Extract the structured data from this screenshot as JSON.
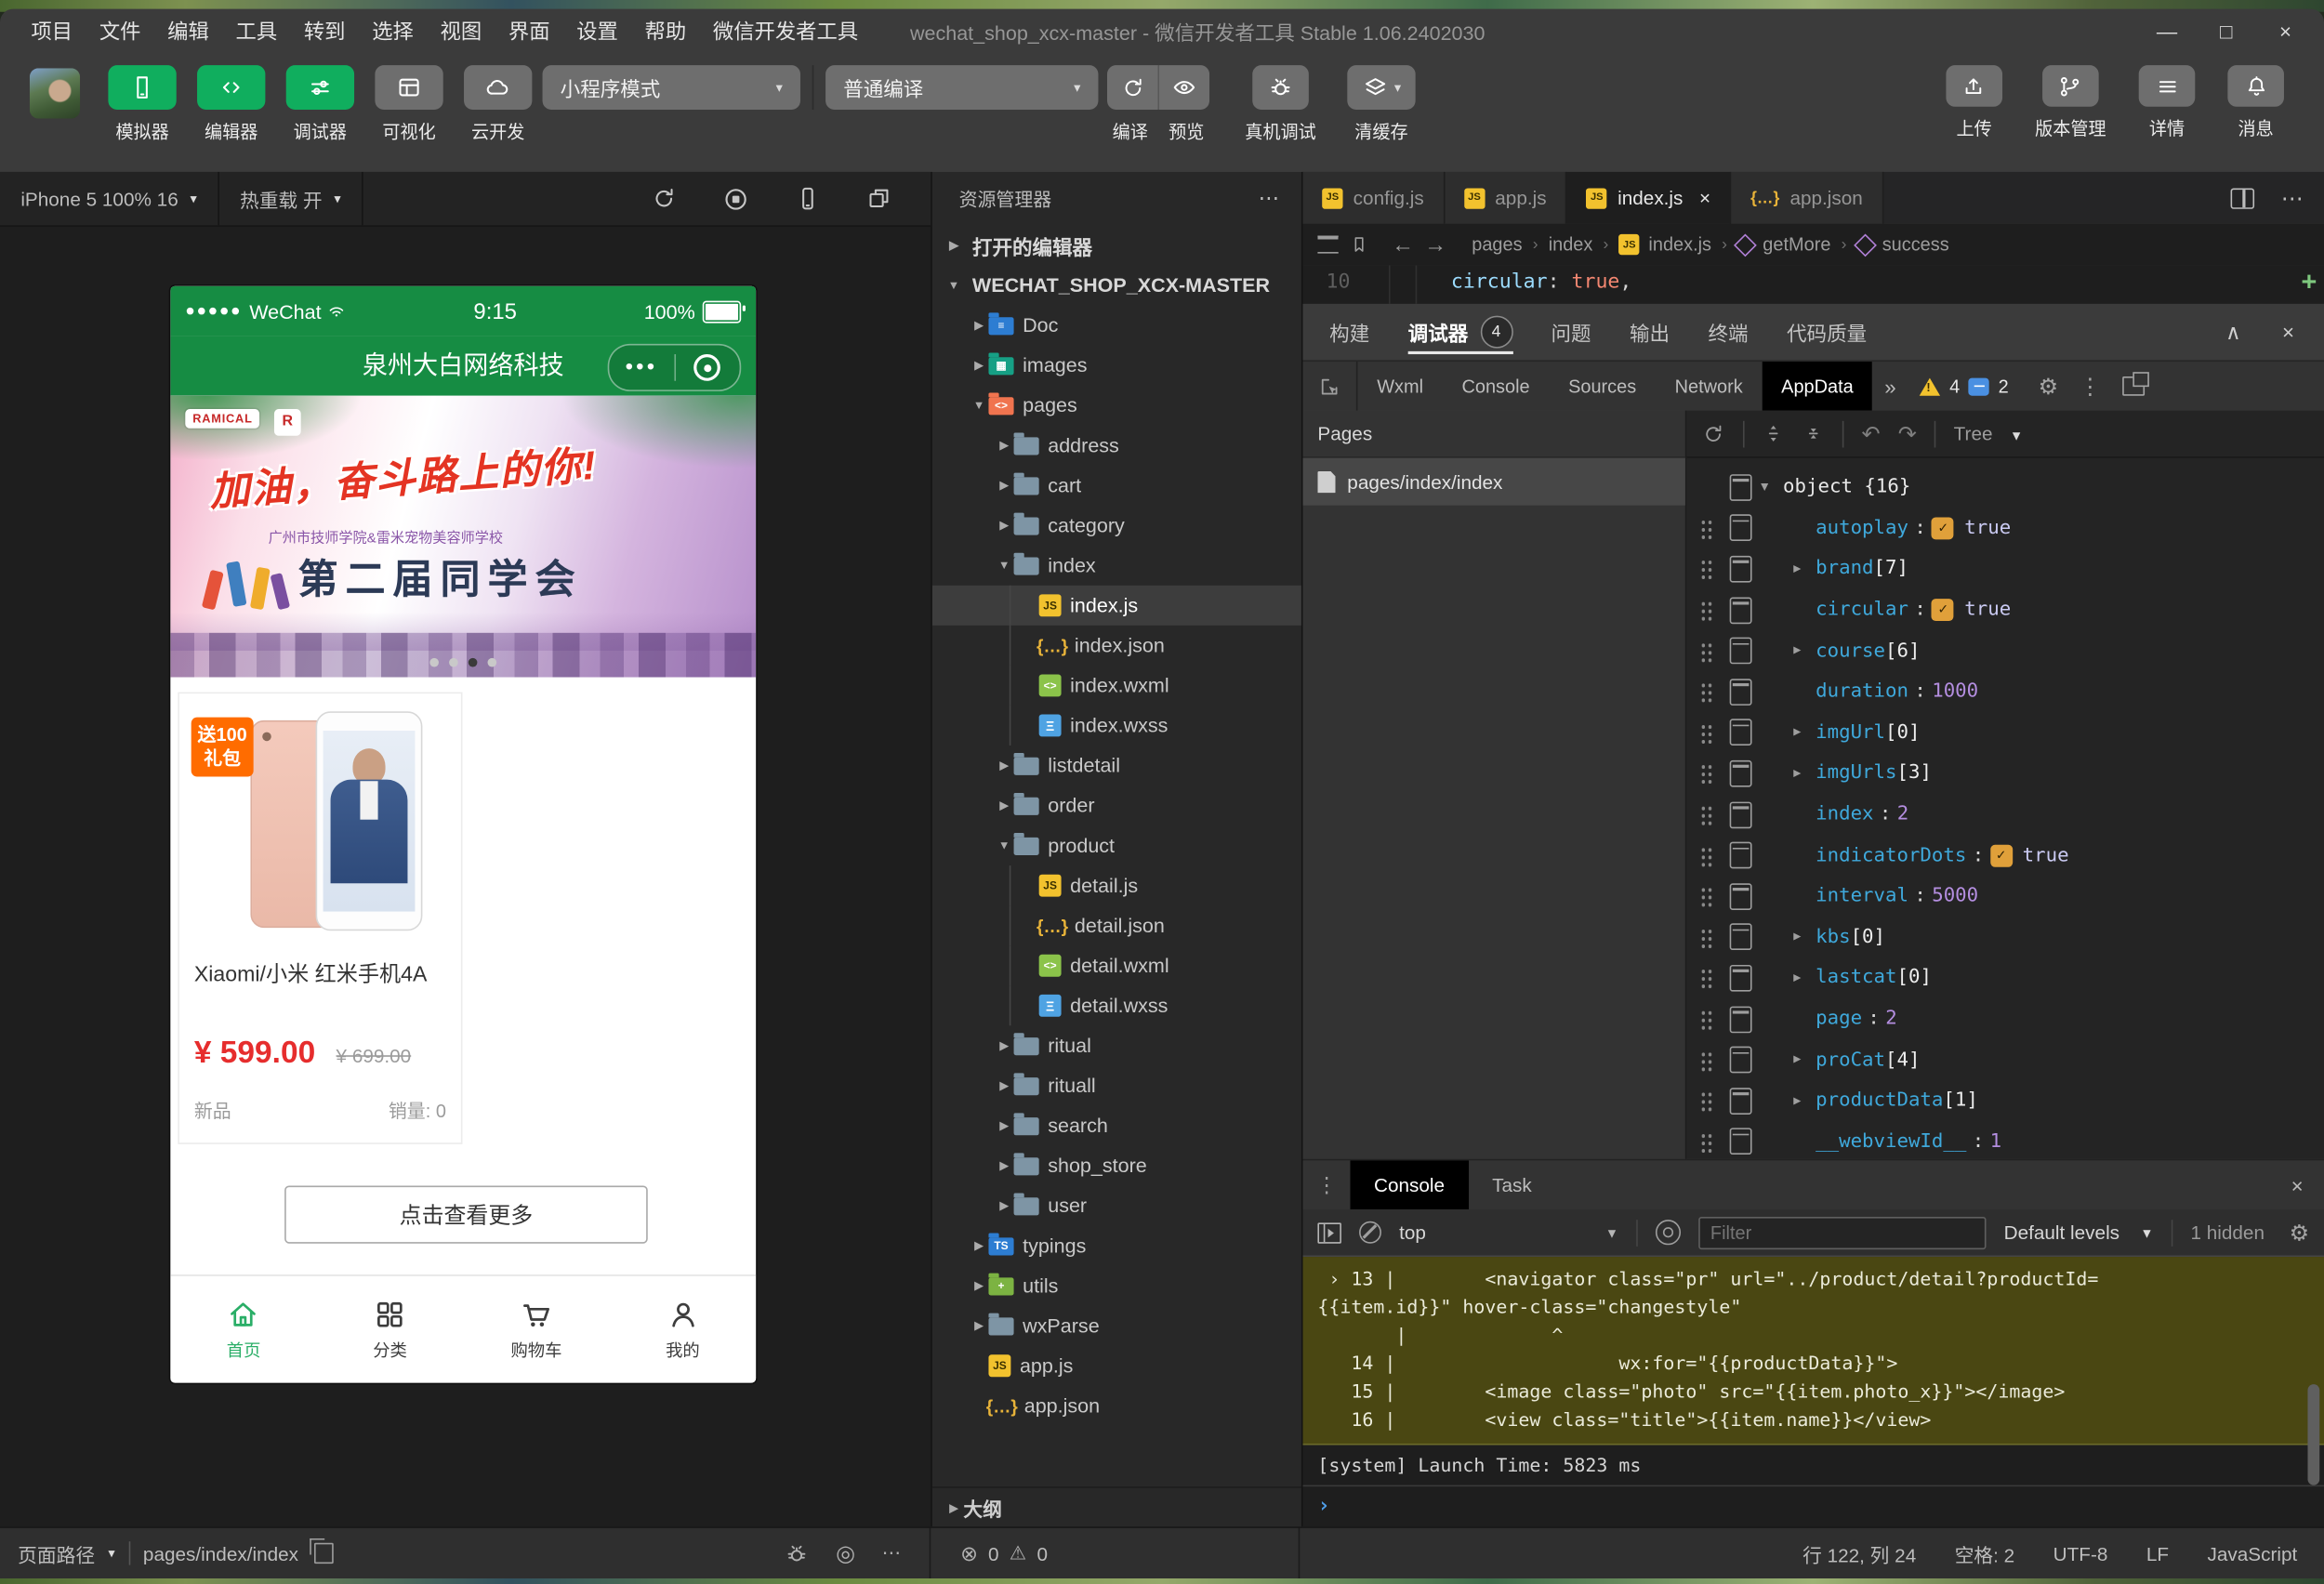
{
  "window": {
    "menus": [
      "项目",
      "文件",
      "编辑",
      "工具",
      "转到",
      "选择",
      "视图",
      "界面",
      "设置",
      "帮助",
      "微信开发者工具"
    ],
    "title": "wechat_shop_xcx-master - 微信开发者工具 Stable 1.06.2402030",
    "controls": {
      "minimize": "—",
      "maximize": "□",
      "close": "×"
    }
  },
  "toolbar": {
    "primary": [
      {
        "label": "模拟器",
        "icon": "phone",
        "active": true
      },
      {
        "label": "编辑器",
        "icon": "code",
        "active": true
      },
      {
        "label": "调试器",
        "icon": "sliders",
        "active": true
      },
      {
        "label": "可视化",
        "icon": "layout",
        "active": false
      },
      {
        "label": "云开发",
        "icon": "cloud",
        "active": false
      }
    ],
    "mode_select": "小程序模式",
    "compile_select": "普通编译",
    "compile_label": "编译",
    "preview_label": "预览",
    "remote_debug_label": "真机调试",
    "clear_cache_label": "清缓存",
    "right_actions": [
      {
        "label": "上传",
        "icon": "upload"
      },
      {
        "label": "版本管理",
        "icon": "branch"
      },
      {
        "label": "详情",
        "icon": "menu"
      },
      {
        "label": "消息",
        "icon": "bell"
      }
    ]
  },
  "simulator": {
    "device": "iPhone 5 100% 16",
    "hot_reload": "热重载 开"
  },
  "phone": {
    "status": {
      "signal": "●●●●●",
      "carrier": "WeChat",
      "time": "9:15",
      "battery": "100%"
    },
    "nav_title": "泉州大白网络科技",
    "banner": {
      "logo": "RAMICAL",
      "logo2": "R",
      "slogan": "加油，奋斗路上的你!",
      "subtitle": "广州市技师学院&雷米宠物美容师学校",
      "event": "第二届同学会",
      "dots": 4,
      "active_dot": 2
    },
    "product": {
      "badge_line1": "送100",
      "badge_line2": "礼包",
      "name": "Xiaomi/小米 红米手机4A",
      "price": "¥ 599.00",
      "original_price": "¥ 699.00",
      "tag": "新品",
      "sales": "销量: 0"
    },
    "more_button": "点击查看更多",
    "tabbar": [
      {
        "label": "首页",
        "icon": "home",
        "active": true
      },
      {
        "label": "分类",
        "icon": "grid",
        "active": false
      },
      {
        "label": "购物车",
        "icon": "cart",
        "active": false
      },
      {
        "label": "我的",
        "icon": "user",
        "active": false
      }
    ]
  },
  "explorer": {
    "header": "资源管理器",
    "more": "⋯",
    "tree": [
      {
        "label": "打开的编辑器",
        "icon": "none",
        "depth": 0,
        "arrow": "right",
        "bold": true
      },
      {
        "label": "WECHAT_SHOP_XCX-MASTER",
        "icon": "none",
        "depth": 0,
        "arrow": "down",
        "bold": true
      },
      {
        "label": "Doc",
        "icon": "folder-doc",
        "depth": 1,
        "arrow": "right"
      },
      {
        "label": "images",
        "icon": "folder-images",
        "depth": 1,
        "arrow": "right"
      },
      {
        "label": "pages",
        "icon": "folder-pages",
        "depth": 1,
        "arrow": "down"
      },
      {
        "label": "address",
        "icon": "folder",
        "depth": 2,
        "arrow": "right"
      },
      {
        "label": "cart",
        "icon": "folder",
        "depth": 2,
        "arrow": "right"
      },
      {
        "label": "category",
        "icon": "folder",
        "depth": 2,
        "arrow": "right"
      },
      {
        "label": "index",
        "icon": "folder-open",
        "depth": 2,
        "arrow": "down"
      },
      {
        "label": "index.js",
        "icon": "js",
        "depth": 3,
        "arrow": "none",
        "selected": true
      },
      {
        "label": "index.json",
        "icon": "json",
        "depth": 3,
        "arrow": "none"
      },
      {
        "label": "index.wxml",
        "icon": "wxml",
        "depth": 3,
        "arrow": "none"
      },
      {
        "label": "index.wxss",
        "icon": "wxss",
        "depth": 3,
        "arrow": "none"
      },
      {
        "label": "listdetail",
        "icon": "folder",
        "depth": 2,
        "arrow": "right"
      },
      {
        "label": "order",
        "icon": "folder",
        "depth": 2,
        "arrow": "right"
      },
      {
        "label": "product",
        "icon": "folder-open",
        "depth": 2,
        "arrow": "down"
      },
      {
        "label": "detail.js",
        "icon": "js",
        "depth": 3,
        "arrow": "none"
      },
      {
        "label": "detail.json",
        "icon": "json",
        "depth": 3,
        "arrow": "none"
      },
      {
        "label": "detail.wxml",
        "icon": "wxml",
        "depth": 3,
        "arrow": "none"
      },
      {
        "label": "detail.wxss",
        "icon": "wxss",
        "depth": 3,
        "arrow": "none"
      },
      {
        "label": "ritual",
        "icon": "folder",
        "depth": 2,
        "arrow": "right"
      },
      {
        "label": "rituall",
        "icon": "folder",
        "depth": 2,
        "arrow": "right"
      },
      {
        "label": "search",
        "icon": "folder",
        "depth": 2,
        "arrow": "right"
      },
      {
        "label": "shop_store",
        "icon": "folder",
        "depth": 2,
        "arrow": "right"
      },
      {
        "label": "user",
        "icon": "folder",
        "depth": 2,
        "arrow": "right"
      },
      {
        "label": "typings",
        "icon": "folder-ts",
        "depth": 1,
        "arrow": "right"
      },
      {
        "label": "utils",
        "icon": "folder-utils",
        "depth": 1,
        "arrow": "right"
      },
      {
        "label": "wxParse",
        "icon": "folder",
        "depth": 1,
        "arrow": "right"
      },
      {
        "label": "app.js",
        "icon": "js",
        "depth": 1,
        "arrow": "none"
      },
      {
        "label": "app.json",
        "icon": "json",
        "depth": 1,
        "arrow": "none"
      }
    ],
    "outline": "大纲"
  },
  "editor": {
    "tabs": [
      {
        "label": "config.js",
        "icon": "js",
        "active": false
      },
      {
        "label": "app.js",
        "icon": "js",
        "active": false
      },
      {
        "label": "index.js",
        "icon": "js",
        "active": true,
        "close": "×"
      },
      {
        "label": "app.json",
        "icon": "json",
        "active": false
      }
    ],
    "breadcrumb": [
      {
        "label": "pages",
        "icon": "none"
      },
      {
        "label": "index",
        "icon": "none"
      },
      {
        "label": "index.js",
        "icon": "js"
      },
      {
        "label": "getMore",
        "icon": "symbol"
      },
      {
        "label": "success",
        "icon": "symbol"
      }
    ],
    "code": {
      "line_number": "10",
      "tokens": [
        {
          "t": "circular",
          "c": "key"
        },
        {
          "t": ": ",
          "c": "plain"
        },
        {
          "t": "true",
          "c": "val"
        },
        {
          "t": ",",
          "c": "plain"
        }
      ]
    }
  },
  "debugger": {
    "panel_tabs": [
      {
        "label": "构建",
        "active": false
      },
      {
        "label": "调试器",
        "active": true,
        "badge": "4"
      },
      {
        "label": "问题",
        "active": false
      },
      {
        "label": "输出",
        "active": false
      },
      {
        "label": "终端",
        "active": false
      },
      {
        "label": "代码质量",
        "active": false
      }
    ],
    "collapse": "∧",
    "close": "×",
    "devtools_tabs": [
      {
        "label": "Wxml",
        "active": false
      },
      {
        "label": "Console",
        "active": false
      },
      {
        "label": "Sources",
        "active": false
      },
      {
        "label": "Network",
        "active": false
      },
      {
        "label": "AppData",
        "active": true
      }
    ],
    "more": "»",
    "warning_count": "4",
    "message_count": "2"
  },
  "appdata": {
    "pages_header": "Pages",
    "page_item": "pages/index/index",
    "tree_mode": "Tree",
    "root": "object {16}",
    "entries": [
      {
        "key": "autoplay",
        "type": "bool",
        "value": "true"
      },
      {
        "key": "brand",
        "type": "array",
        "value": "[7]"
      },
      {
        "key": "circular",
        "type": "bool",
        "value": "true"
      },
      {
        "key": "course",
        "type": "array",
        "value": "[6]"
      },
      {
        "key": "duration",
        "type": "number",
        "value": "1000"
      },
      {
        "key": "imgUrl",
        "type": "array",
        "value": "[0]"
      },
      {
        "key": "imgUrls",
        "type": "array",
        "value": "[3]"
      },
      {
        "key": "index",
        "type": "number",
        "value": "2"
      },
      {
        "key": "indicatorDots",
        "type": "bool",
        "value": "true"
      },
      {
        "key": "interval",
        "type": "number",
        "value": "5000"
      },
      {
        "key": "kbs",
        "type": "array",
        "value": "[0]"
      },
      {
        "key": "lastcat",
        "type": "array",
        "value": "[0]"
      },
      {
        "key": "page",
        "type": "number",
        "value": "2"
      },
      {
        "key": "proCat",
        "type": "array",
        "value": "[4]"
      },
      {
        "key": "productData",
        "type": "array",
        "value": "[1]"
      },
      {
        "key": "__webviewId__",
        "type": "number",
        "value": "1"
      }
    ]
  },
  "console": {
    "tabs": [
      {
        "label": "Console",
        "active": true
      },
      {
        "label": "Task",
        "active": false
      }
    ],
    "close": "×",
    "context": "top",
    "filter_placeholder": "Filter",
    "levels": "Default levels",
    "hidden": "1 hidden",
    "warning_lines": [
      " › 13 |        <navigator class=\"pr\" url=\"../product/detail?productId=",
      "{{item.id}}\" hover-class=\"changestyle\"",
      "       |             ^",
      "   14 |                    wx:for=\"{{productData}}\">",
      "   15 |        <image class=\"photo\" src=\"{{item.photo_x}}\"></image>",
      "   16 |        <view class=\"title\">{{item.name}}</view>"
    ],
    "system_line": "[system] Launch Time: 5823 ms",
    "prompt": "›"
  },
  "statusbar": {
    "left_label": "页面路径",
    "path": "pages/index/index",
    "errors": "0",
    "warnings": "0",
    "line_col": "行 122, 列 24",
    "spaces": "空格: 2",
    "encoding": "UTF-8",
    "eol": "LF",
    "language": "JavaScript"
  }
}
